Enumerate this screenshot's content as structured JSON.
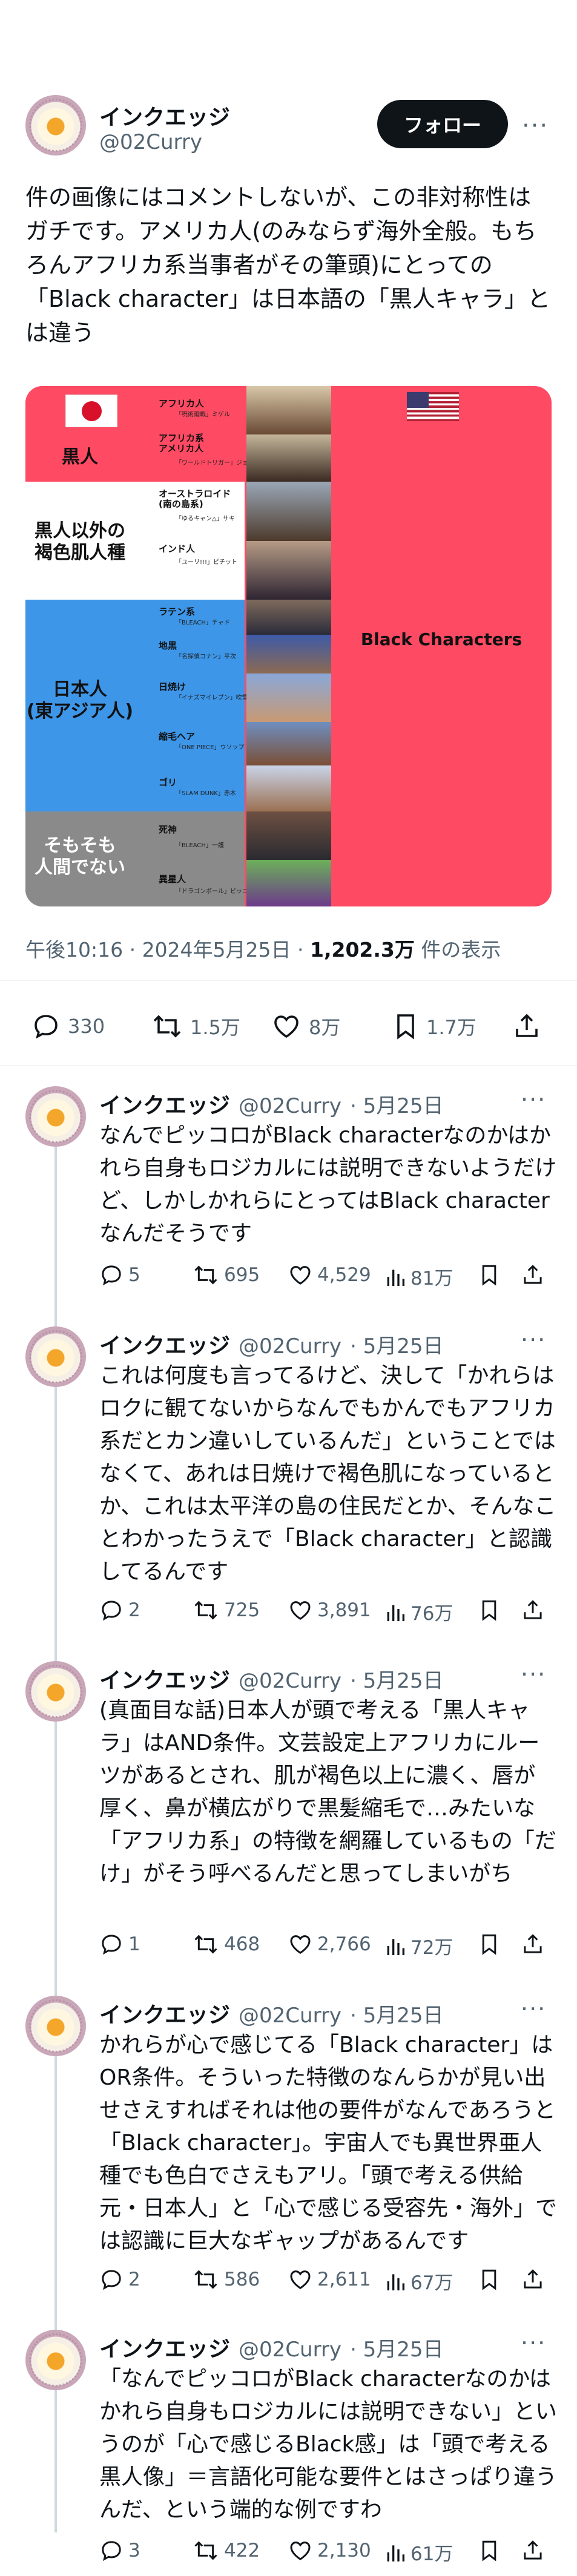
{
  "main": {
    "display_name": "インクエッジ",
    "handle": "@02Curry",
    "follow_label": "フォロー",
    "text": "件の画像にはコメントしないが、この非対称性はガチです。アメリカ人(のみならず海外全般。もちろんアフリカ系当事者がその筆頭)にとっての「Black character」は日本語の「黒人キャラ」とは違う",
    "timestamp": "午後10:16 · 2024年5月25日 · ",
    "views": "1,202.3万",
    "views_suffix": " 件の表示",
    "replies": "330",
    "retweets": "1.5万",
    "likes": "8万",
    "bookmarks": "1.7万"
  },
  "graphic": {
    "band_black": "黒人",
    "band_brown": "黒人以外の\n褐色肌人種",
    "band_asian": "日本人\n(東アジア人)",
    "band_nonhuman": "そもそも\n人間でない",
    "right_label": "Black Characters",
    "rows": [
      {
        "label": "アフリカ人",
        "note": "「呪術廻戦」ミゲル"
      },
      {
        "label": "アフリカ系\nアメリカ人",
        "note": "「ワールドトリガー」ジョー"
      },
      {
        "label": "オーストラロイド\n(南の島系)",
        "note": "「ゆるキャン△」サキ"
      },
      {
        "label": "インド人",
        "note": "「ユーリ!!!」ピチット"
      },
      {
        "label": "ラテン系",
        "note": "「BLEACH」チャド"
      },
      {
        "label": "地黒",
        "note": "「名探偵コナン」平次"
      },
      {
        "label": "日焼け",
        "note": "「イナズマイレブン」吹雪"
      },
      {
        "label": "縮毛ヘア",
        "note": "「ONE PIECE」ウソップ"
      },
      {
        "label": "ゴリ",
        "note": "「SLAM DUNK」赤木"
      },
      {
        "label": "死神",
        "note": "「BLEACH」一護"
      },
      {
        "label": "異星人",
        "note": "「ドラゴンボール」ピッコロ"
      }
    ]
  },
  "replies": [
    {
      "name": "インクエッジ",
      "handle": "@02Curry",
      "date": "· 5月25日",
      "text": "なんでピッコロがBlack characterなのかはかれら自身もロジカルには説明できないようだけど、しかしかれらにとってはBlack characterなんだそうです",
      "replies": "5",
      "retweets": "695",
      "likes": "4,529",
      "views": "81万"
    },
    {
      "name": "インクエッジ",
      "handle": "@02Curry",
      "date": "· 5月25日",
      "text": "これは何度も言ってるけど、決して「かれらはロクに観てないからなんでもかんでもアフリカ系だとカン違いしているんだ」ということではなくて、あれは日焼けで褐色肌になっているとか、これは太平洋の島の住民だとか、そんなことわかったうえで「Black character」と認識してるんです",
      "replies": "2",
      "retweets": "725",
      "likes": "3,891",
      "views": "76万"
    },
    {
      "name": "インクエッジ",
      "handle": "@02Curry",
      "date": "· 5月25日",
      "text": "(真面目な話)日本人が頭で考える「黒人キャラ」はAND条件。文芸設定上アフリカにルーツがあるとされ、肌が褐色以上に濃く、唇が厚く、鼻が横広がりで黒髪縮毛で…みたいな「アフリカ系」の特徴を網羅しているもの「だけ」がそう呼べるんだと思ってしまいがち",
      "replies": "1",
      "retweets": "468",
      "likes": "2,766",
      "views": "72万"
    },
    {
      "name": "インクエッジ",
      "handle": "@02Curry",
      "date": "· 5月25日",
      "text": "かれらが心で感じてる「Black character」はOR条件。そういった特徴のなんらかが見い出せさえすればそれは他の要件がなんであろうと「Black character」。宇宙人でも異世界亜人種でも色白でさえもアリ。「頭で考える供給元・日本人」と「心で感じる受容先・海外」では認識に巨大なギャップがあるんです",
      "replies": "2",
      "retweets": "586",
      "likes": "2,611",
      "views": "67万"
    },
    {
      "name": "インクエッジ",
      "handle": "@02Curry",
      "date": "· 5月25日",
      "text": "「なんでピッコロがBlack characterなのかはかれら自身もロジカルには説明できない」というのが「心で感じるBlack感」は「頭で考える黒人像」＝言語化可能な要件とはさっぱり違うんだ、という端的な例ですわ",
      "replies": "3",
      "retweets": "422",
      "likes": "2,130",
      "views": "61万"
    }
  ]
}
